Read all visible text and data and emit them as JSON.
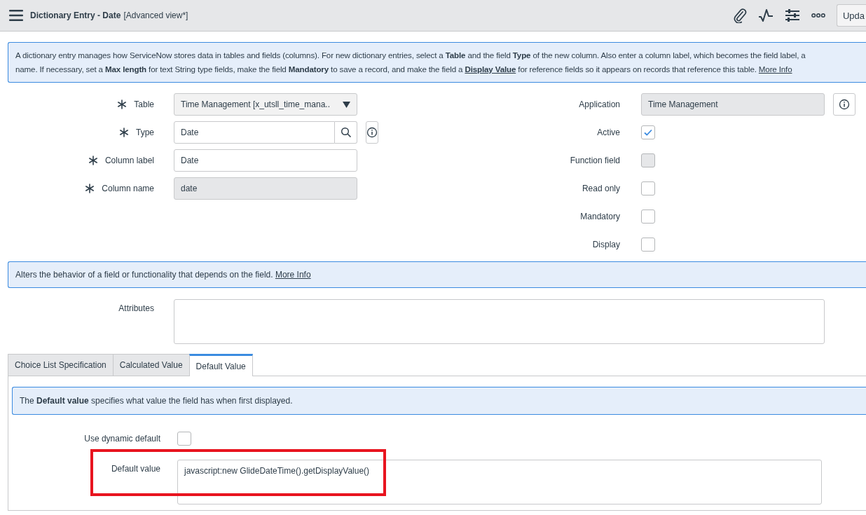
{
  "header": {
    "title": "Dictionary Entry - Date",
    "view": "[Advanced view*]",
    "button": "Upda"
  },
  "intro": {
    "line1": "A dictionary entry manages how ServiceNow stores data in tables and fields (columns). For new dictionary entries, select a **Table** and the field **Type** of the new column. Also enter a column label, which becomes the field label, a",
    "line2": [
      {
        "kind": "text",
        "text": "name. If necessary, set a **Max length** for text String type fields, make the field **Mandatory** to save a record, and make the field a "
      },
      {
        "kind": "link",
        "text": "Display Value",
        "bold": true
      },
      {
        "kind": "text",
        "text": " for reference fields so it appears on records that reference this table. "
      },
      {
        "kind": "link",
        "text": "More Info",
        "bold": false
      }
    ]
  },
  "left_fields": [
    {
      "label": "Table",
      "required": true,
      "kind": "select",
      "value": "Time Management [x_utsll_time_mana.."
    },
    {
      "label": "Type",
      "required": true,
      "kind": "lookup",
      "value": "Date"
    },
    {
      "label": "Column label",
      "required": true,
      "kind": "text",
      "value": "Date"
    },
    {
      "label": "Column name",
      "required": true,
      "kind": "readonly",
      "value": "date"
    }
  ],
  "right_fields": [
    {
      "label": "Application",
      "kind": "reference",
      "value": "Time Management"
    },
    {
      "label": "Active",
      "kind": "checkbox",
      "checked": true,
      "disabled": false
    },
    {
      "label": "Function field",
      "kind": "checkbox",
      "checked": false,
      "disabled": true
    },
    {
      "label": "Read only",
      "kind": "checkbox",
      "checked": false,
      "disabled": false
    },
    {
      "label": "Mandatory",
      "kind": "checkbox",
      "checked": false,
      "disabled": false
    },
    {
      "label": "Display",
      "kind": "checkbox",
      "checked": false,
      "disabled": false
    }
  ],
  "attributes_info": {
    "text": "Alters the behavior of a field or functionality that depends on the field. ",
    "link": "More Info"
  },
  "attributes": {
    "label": "Attributes"
  },
  "tabs": [
    {
      "label": "Choice List Specification",
      "selected": false
    },
    {
      "label": "Calculated Value",
      "selected": false
    },
    {
      "label": "Default Value",
      "selected": true
    }
  ],
  "default_tab": {
    "info": "The **Default value** specifies what value the field has when first displayed.",
    "dynamic": {
      "label": "Use dynamic default",
      "checked": false
    },
    "default_value": {
      "label": "Default value",
      "value": "javascript:new GlideDateTime().getDisplayValue()",
      "highlighted": true
    }
  }
}
